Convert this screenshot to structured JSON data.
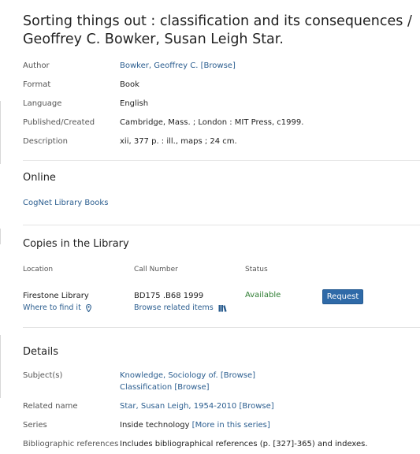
{
  "title": "Sorting things out : classification and its consequences / Geoffrey C. Bowker, Susan Leigh Star.",
  "fields": {
    "author": {
      "label": "Author",
      "value": "Bowker, Geoffrey C.",
      "browse": "[Browse]"
    },
    "format": {
      "label": "Format",
      "value": "Book"
    },
    "language": {
      "label": "Language",
      "value": "English"
    },
    "published": {
      "label": "Published/Created",
      "value": "Cambridge, Mass. ; London : MIT Press, c1999."
    },
    "description": {
      "label": "Description",
      "value": "xii, 377 p. : ill., maps ; 24 cm."
    }
  },
  "online": {
    "heading": "Online",
    "link": "CogNet Library Books"
  },
  "copies": {
    "heading": "Copies in the Library",
    "columns": {
      "location": "Location",
      "call_number": "Call Number",
      "status": "Status"
    },
    "row": {
      "location": "Firestone Library",
      "where_link": "Where to find it",
      "call_number": "BD175 .B68 1999",
      "browse_related": "Browse related items",
      "status": "Available",
      "request": "Request"
    }
  },
  "details": {
    "heading": "Details",
    "subjects": {
      "label": "Subject(s)",
      "items": [
        {
          "text": "Knowledge, Sociology of.",
          "browse": "[Browse]"
        },
        {
          "text": "Classification",
          "browse": "[Browse]"
        }
      ]
    },
    "related_name": {
      "label": "Related name",
      "value": "Star, Susan Leigh, 1954-2010",
      "browse": "[Browse]"
    },
    "series": {
      "label": "Series",
      "value": "Inside technology",
      "link": "[More in this series]"
    },
    "bibliographic": {
      "label": "Bibliographic references",
      "value": "Includes bibliographical references (p. [327]-365) and indexes."
    }
  },
  "colors": {
    "link": "#2a5d8f",
    "available": "#2e7d32",
    "button": "#2f6aa8"
  },
  "icons": {
    "where_to_find": "map-marker-icon",
    "browse_related": "books-icon"
  }
}
